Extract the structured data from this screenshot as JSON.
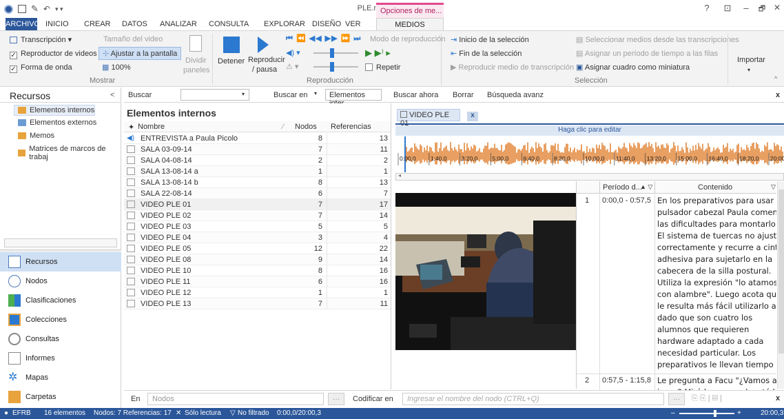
{
  "titlebar": {
    "title": "PLE.nvp - NVivo Pro",
    "context_tab": "Opciones de me...",
    "help": "?",
    "ribbon_opts": "⊡",
    "minimize": "–",
    "restore": "🗗",
    "close": "✕"
  },
  "tabs": [
    "ARCHIVO",
    "INICIO",
    "CREAR",
    "DATOS",
    "ANALIZAR",
    "CONSULTA",
    "EXPLORAR",
    "DISEÑO",
    "VER",
    "MEDIOS"
  ],
  "ribbon": {
    "transcripcion": "Transcripción",
    "reproductor": "Reproductor de videos",
    "forma_onda": "Forma de onda",
    "tamano": "Tamaño del video",
    "ajustar": "Ajustar a la pantalla",
    "zoom": "100%",
    "dividir": "Dividir",
    "paneles": "paneles",
    "mostrar": "Mostrar",
    "detener": "Detener",
    "reproducir": "Reproducir",
    "pausa": "/ pausa",
    "reproduccion": "Reproducción",
    "modo": "Modo de reproducción",
    "repetir": "Repetir",
    "inicio_sel": "Inicio de la selección",
    "fin_sel": "Fin de la selección",
    "reproducir_medio": "Reproducir medio de transcripción",
    "sel_medios": "Seleccionar medios desde las transcripciones",
    "asignar": "Asignar un período de tiempo a las filas",
    "miniatura": "Asignar cuadro como miniatura",
    "seleccion": "Selección",
    "importar": "Importar"
  },
  "findbar": {
    "buscar": "Buscar",
    "buscar_en": "Buscar en",
    "elementos": "Elementos inter",
    "buscar_ahora": "Buscar ahora",
    "borrar": "Borrar",
    "avanzada": "Búsqueda avanz",
    "close": "x"
  },
  "left": {
    "title": "Recursos",
    "collapse": "<",
    "tree": [
      "Elementos internos",
      "Elementos externos",
      "Memos",
      "Matrices de marcos de trabaj"
    ],
    "nav": [
      "Recursos",
      "Nodos",
      "Clasificaciones",
      "Colecciones",
      "Consultas",
      "Informes",
      "Mapas",
      "Carpetas"
    ]
  },
  "list": {
    "title": "Elementos internos",
    "cols": {
      "nombre": "Nombre",
      "nodos": "Nodos",
      "referencias": "Referencias"
    },
    "rows": [
      {
        "name": "ENTREVISTA a Paula Picolo",
        "nodes": "8",
        "refs": "13",
        "type": "audio"
      },
      {
        "name": "SALA 03-09-14",
        "nodes": "7",
        "refs": "11",
        "type": "video"
      },
      {
        "name": "SALA 04-08-14",
        "nodes": "2",
        "refs": "2",
        "type": "video"
      },
      {
        "name": "SALA 13-08-14 a",
        "nodes": "1",
        "refs": "1",
        "type": "video"
      },
      {
        "name": "SALA 13-08-14 b",
        "nodes": "8",
        "refs": "13",
        "type": "video"
      },
      {
        "name": "SALA 22-08-14",
        "nodes": "6",
        "refs": "7",
        "type": "video"
      },
      {
        "name": "VIDEO PLE 01",
        "nodes": "7",
        "refs": "17",
        "type": "video"
      },
      {
        "name": "VIDEO PLE 02",
        "nodes": "7",
        "refs": "14",
        "type": "video"
      },
      {
        "name": "VIDEO PLE 03",
        "nodes": "5",
        "refs": "5",
        "type": "video"
      },
      {
        "name": "VIDEO PLE 04",
        "nodes": "3",
        "refs": "4",
        "type": "video"
      },
      {
        "name": "VIDEO PLE 05",
        "nodes": "12",
        "refs": "22",
        "type": "video"
      },
      {
        "name": "VIDEO PLE 08",
        "nodes": "9",
        "refs": "14",
        "type": "video"
      },
      {
        "name": "VIDEO PLE 10",
        "nodes": "8",
        "refs": "16",
        "type": "video"
      },
      {
        "name": "VIDEO PLE 11",
        "nodes": "6",
        "refs": "16",
        "type": "video"
      },
      {
        "name": "VIDEO PLE 12",
        "nodes": "1",
        "refs": "1",
        "type": "video"
      },
      {
        "name": "VIDEO PLE 13",
        "nodes": "7",
        "refs": "11",
        "type": "video"
      }
    ]
  },
  "detail": {
    "tab": "VIDEO PLE 01",
    "tab_close": "x",
    "edit_hint": "Haga clic para editar",
    "ticks": [
      "0:00,0",
      "1:40,0",
      "3:20,0",
      "5:00,0",
      "6:40,0",
      "8:20,0",
      "10:00,0",
      "11:40,0",
      "13:20,0",
      "15:00,0",
      "16:40,0",
      "18:20,0",
      "20:00"
    ],
    "cols": {
      "periodo": "Período d...",
      "contenido": "Contenido"
    },
    "rows": [
      {
        "num": "1",
        "period": "0:00,0 - 0:57,5",
        "lines": [
          "En los preparativos para usar el",
          "pulsador cabezal Paula comenta",
          "las dificultades para montarlo.",
          "El sistema de tuercas no ajusta",
          "correctamente y recurre a cinta",
          "adhesiva para sujetarlo en la",
          "cabecera de la silla postural.",
          "Utiliza la expresión \"lo atamos",
          "con alambre\". Luego acota que",
          "le resulta más fácil utilizarlo así",
          "dado que son cuatro los",
          "alumnos que requieren",
          "hardware adaptado a cada",
          "necesidad particular. Los",
          "preparativos le llevan tiempo y"
        ]
      },
      {
        "num": "2",
        "period": "0:57,5 - 1:15,8",
        "lines": [
          "Le pregunta a Facu \"¿Vamos a",
          "jugar? Mirá la compu, levatá la"
        ]
      }
    ]
  },
  "codebar": {
    "en": "En",
    "nodos": "Nodos",
    "codificar": "Codificar en",
    "placeholder": "Ingresar el nombre del nodo (CTRL+Q)",
    "close": "x"
  },
  "status": {
    "user": "EFRB",
    "items": "16 elementos",
    "nodes": "Nodos: 7  Referencias: 17",
    "readonly": "Sólo lectura",
    "filter": "No filtrado",
    "time": "0:00,0/20:00,3",
    "time_right": "20:00,3",
    "minus": "–",
    "plus": "+"
  },
  "colors": {
    "accent": "#2b579a",
    "context": "#e2498a",
    "wave": "#e3873a",
    "play": "#2e8b2e"
  }
}
